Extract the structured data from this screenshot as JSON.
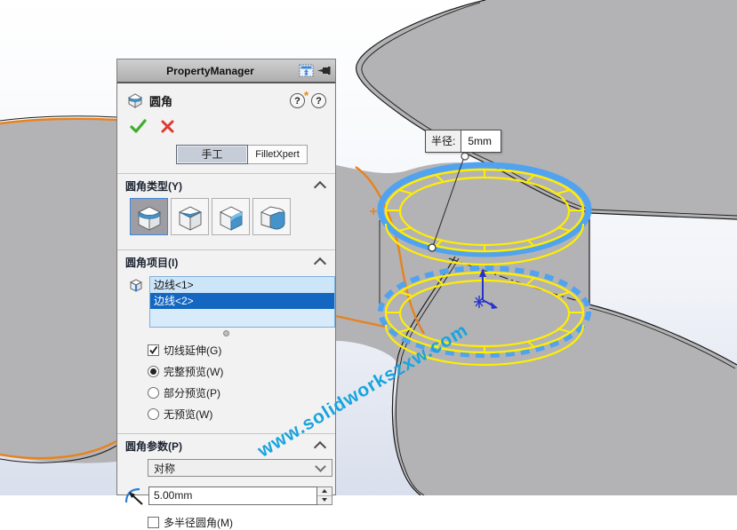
{
  "panel": {
    "title": "PropertyManager",
    "feature_title": "圆角",
    "tabs": {
      "manual": "手工",
      "expert": "FilletXpert"
    },
    "fillet_type": {
      "header": "圆角类型(Y)"
    },
    "fillet_items": {
      "header": "圆角项目(I)",
      "edges": [
        "边线<1>",
        "边线<2>"
      ],
      "tangent_label": "切线延伸(G)",
      "preview_full": "完整预览(W)",
      "preview_partial": "部分预览(P)",
      "preview_none": "无预览(W)"
    },
    "fillet_params": {
      "header": "圆角参数(P)",
      "profile": "对称",
      "radius": "5.00mm",
      "multi_radius_label": "多半径圆角(M)"
    }
  },
  "viewport": {
    "callout_label": "半径:",
    "callout_value": "5mm",
    "watermark": "www.solidworkszxw.com"
  },
  "colors": {
    "selection_yellow": "#ffee00",
    "preview_blue": "#4fa3f0",
    "highlight_orange": "#e8821e",
    "part_gray": "#b3b3b5",
    "selected_item_blue": "#1467c0",
    "watermark_blue": "#18a4de"
  }
}
